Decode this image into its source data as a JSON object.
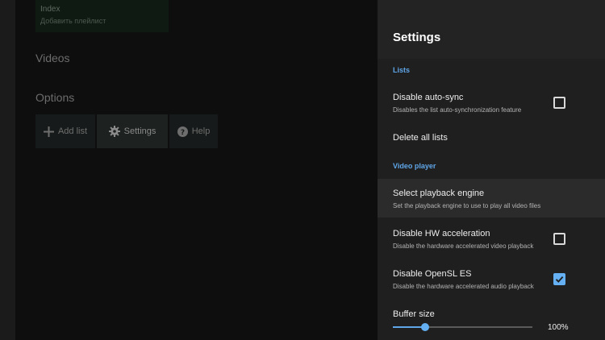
{
  "background": {
    "tile": {
      "title": "Index",
      "subtitle": "Добавить плейлист"
    },
    "sections": {
      "videos": "Videos",
      "options": "Options"
    },
    "options_buttons": [
      {
        "label": "Add list",
        "icon": "plus-icon"
      },
      {
        "label": "Settings",
        "icon": "gear-icon"
      },
      {
        "label": "Help",
        "icon": "help-icon"
      }
    ]
  },
  "settings": {
    "title": "Settings",
    "categories": {
      "lists": "Lists",
      "video_player": "Video player"
    },
    "items": {
      "disable_auto_sync": {
        "title": "Disable auto-sync",
        "subtitle": "Disables the list auto-synchronization feature",
        "checked": false
      },
      "delete_all_lists": {
        "title": "Delete all lists"
      },
      "select_playback_engine": {
        "title": "Select playback engine",
        "subtitle": "Set the playback engine to use to play all video files"
      },
      "disable_hw_acceleration": {
        "title": "Disable HW acceleration",
        "subtitle": "Disable the hardware accelerated video playback",
        "checked": false
      },
      "disable_opensl_es": {
        "title": "Disable OpenSL ES",
        "subtitle": "Disable the hardware accelerated audio playback",
        "checked": true
      },
      "buffer_size": {
        "title": "Buffer size",
        "value_label": "100%",
        "level": 0.23
      }
    }
  },
  "colors": {
    "accent": "#64b0f2",
    "panel": "#1f1f1f",
    "background": "#0e0e0e"
  }
}
